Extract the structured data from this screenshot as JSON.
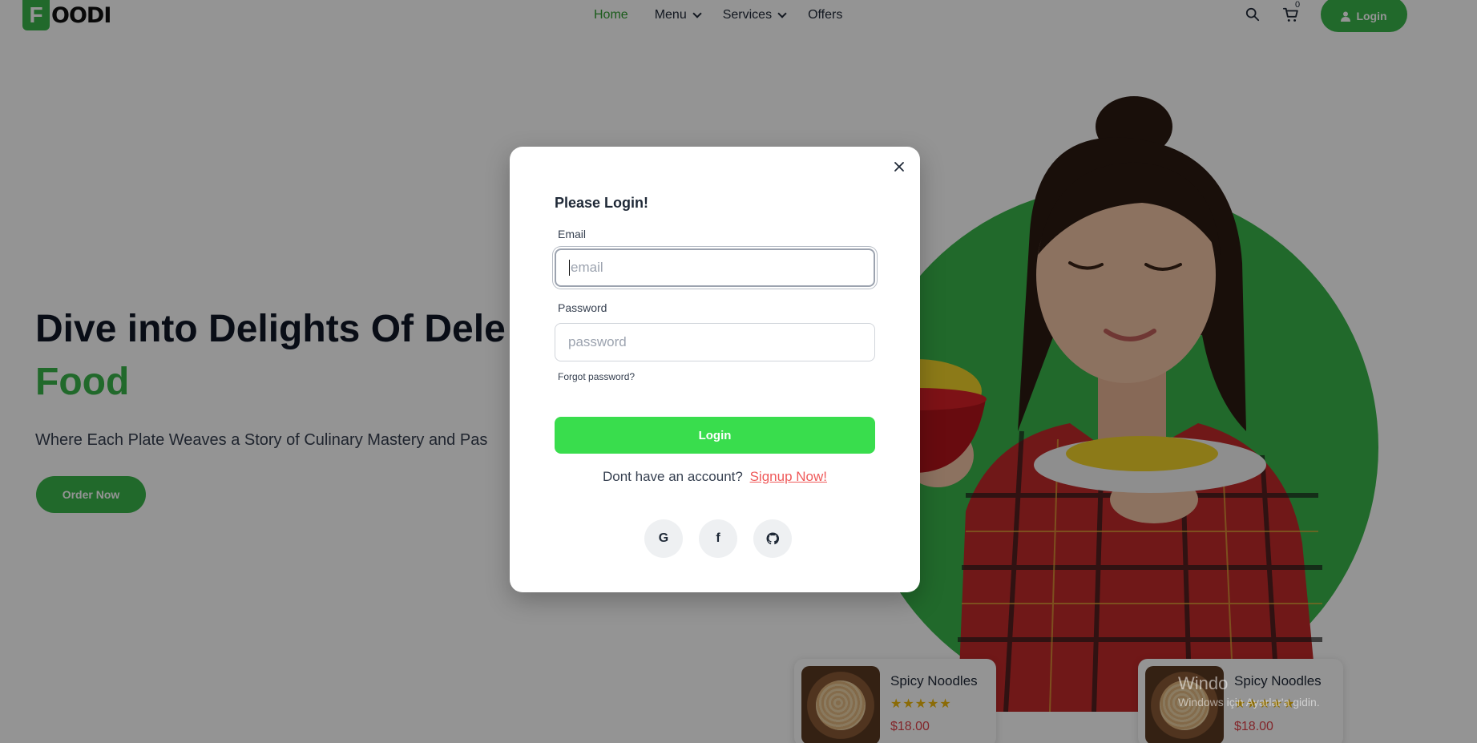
{
  "header": {
    "logo_letter": "F",
    "logo_rest": "OODI",
    "nav": [
      {
        "label": "Home",
        "active": true
      },
      {
        "label": "Menu",
        "has_dropdown": true
      },
      {
        "label": "Services",
        "has_dropdown": true
      },
      {
        "label": "Offers"
      }
    ],
    "cart_count": "0",
    "login_label": "Login",
    "icons": {
      "search": "search-icon",
      "cart": "cart-icon",
      "user": "user-icon"
    }
  },
  "hero": {
    "title_line1": "Dive into Delights Of Dele",
    "title_line2": "Food",
    "subtitle": "Where Each Plate Weaves a Story of Culinary Mastery and Pas",
    "order_label": "Order Now"
  },
  "cards": [
    {
      "title": "Spicy Noodles",
      "stars": "★★★★★",
      "price": "$18.00"
    },
    {
      "title": "Spicy Noodles",
      "stars": "★★★★★",
      "price": "$18.00"
    }
  ],
  "watermark": {
    "title": "Windo",
    "subtitle": "Windows için Ayarlar'a gidin."
  },
  "modal": {
    "title": "Please Login!",
    "email_label": "Email",
    "email_placeholder": "email",
    "password_label": "Password",
    "password_placeholder": "password",
    "forgot": "Forgot password?",
    "login_label": "Login",
    "signup_text": "Dont have an account?",
    "signup_link": "Signup Now!",
    "social": [
      {
        "icon": "google-icon",
        "glyph": "G"
      },
      {
        "icon": "facebook-icon",
        "glyph": "f"
      },
      {
        "icon": "github-icon",
        "glyph": ""
      }
    ]
  },
  "colors": {
    "brand_green": "#39b54a",
    "button_green": "#39dd4d",
    "link_red": "#ef5a5a",
    "price_red": "#e0434a",
    "star_gold": "#f0b90b"
  }
}
